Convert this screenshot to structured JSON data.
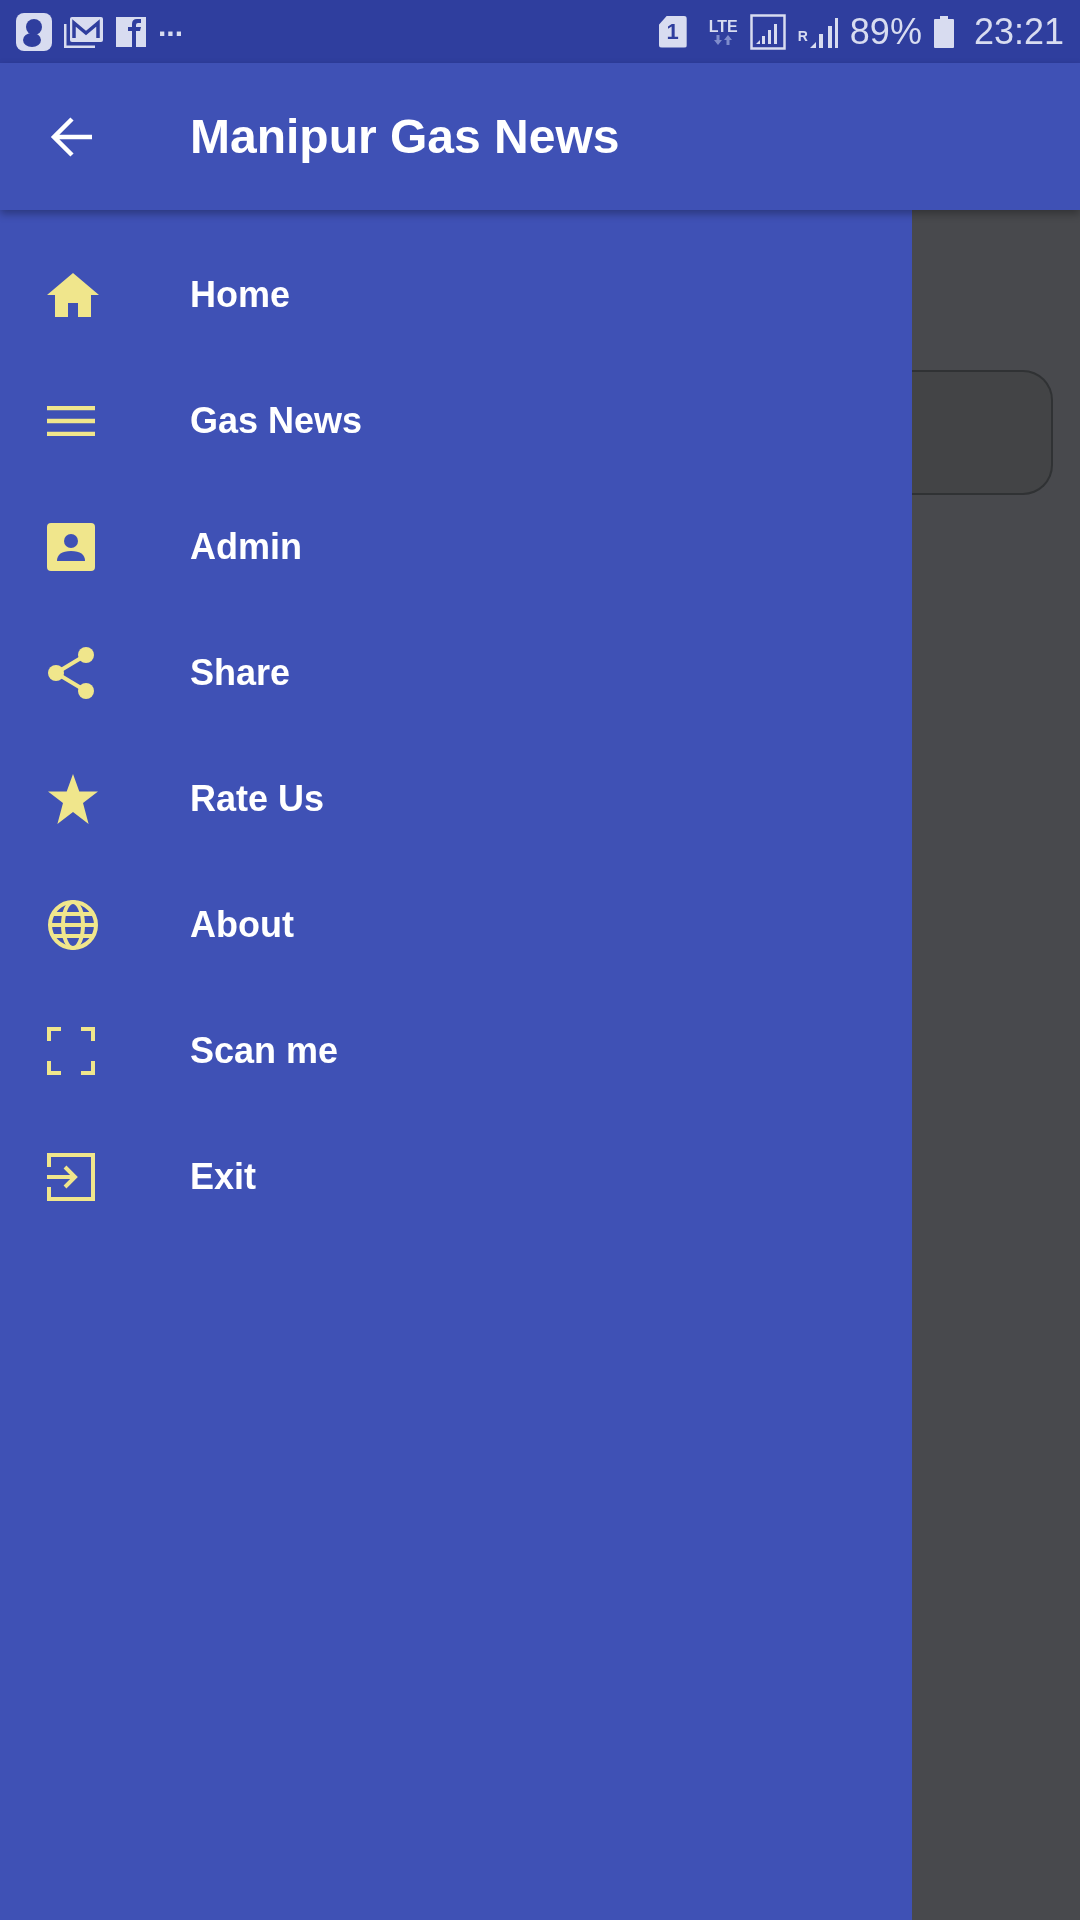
{
  "status_bar": {
    "overflow": "...",
    "sim_slot": "1",
    "network": "LTE",
    "roaming": "R",
    "battery": "89%",
    "time": "23:21"
  },
  "toolbar": {
    "title": "Manipur Gas News"
  },
  "drawer": {
    "items": [
      {
        "kind": "home",
        "label": "Home"
      },
      {
        "kind": "list",
        "label": "Gas News"
      },
      {
        "kind": "contact",
        "label": "Admin"
      },
      {
        "kind": "share",
        "label": "Share"
      },
      {
        "kind": "star",
        "label": "Rate Us"
      },
      {
        "kind": "globe",
        "label": "About"
      },
      {
        "kind": "scan",
        "label": "Scan me"
      },
      {
        "kind": "exit",
        "label": "Exit"
      }
    ]
  }
}
